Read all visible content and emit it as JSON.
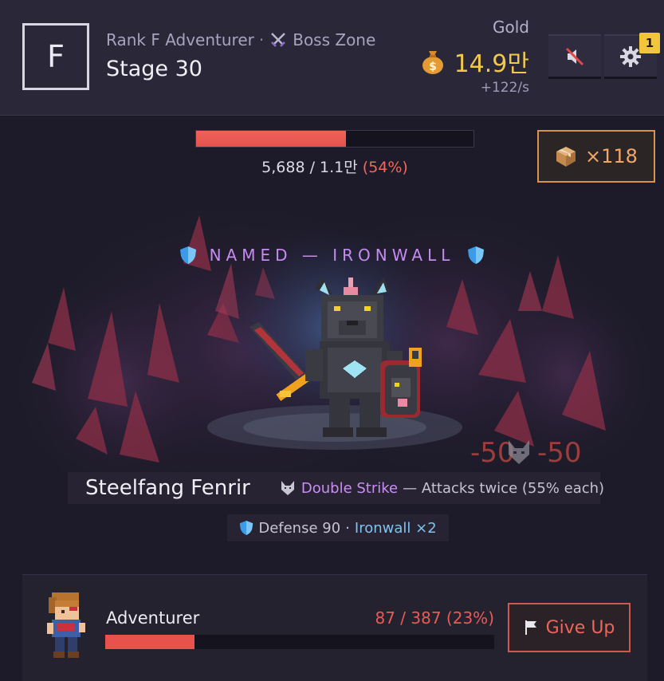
{
  "header": {
    "rank_letter": "F",
    "rank_title": "Rank F Adventurer",
    "separator": "·",
    "zone": "Boss Zone",
    "stage": "Stage 30",
    "gold_label": "Gold",
    "gold_value": "14.9만",
    "gold_rate": "+122/s",
    "settings_badge": "1",
    "icons": {
      "zone": "crossed-swords-icon",
      "gold": "money-bag-icon",
      "mute": "speaker-muted-icon",
      "settings": "gear-icon"
    }
  },
  "boss_hp": {
    "text": "5,688 / 1.1만",
    "percent_text": "(54%)",
    "fill_fraction": 0.54
  },
  "box_counter": {
    "icon": "package-icon",
    "label": "×118"
  },
  "boss": {
    "tag": "NAMED — IRONWALL",
    "name": "Steelfang Fenrir",
    "skill_name": "Double Strike",
    "skill_desc": "— Attacks twice (55% each)",
    "defense_label": "Defense 90",
    "defense_sep": "·",
    "ironwall": "Ironwall ×2",
    "damage_left": "-50",
    "damage_right": "-50"
  },
  "player": {
    "name": "Adventurer",
    "hp_text": "87 / 387 (23%)",
    "hp_fraction": 0.23,
    "give_up": "Give Up"
  },
  "colors": {
    "gold": "#f2c84b",
    "hp_red": "#e9514d",
    "named_purple": "#c58cf0",
    "ironwall_blue": "#7fc3ef",
    "box_orange": "#d6934e"
  }
}
